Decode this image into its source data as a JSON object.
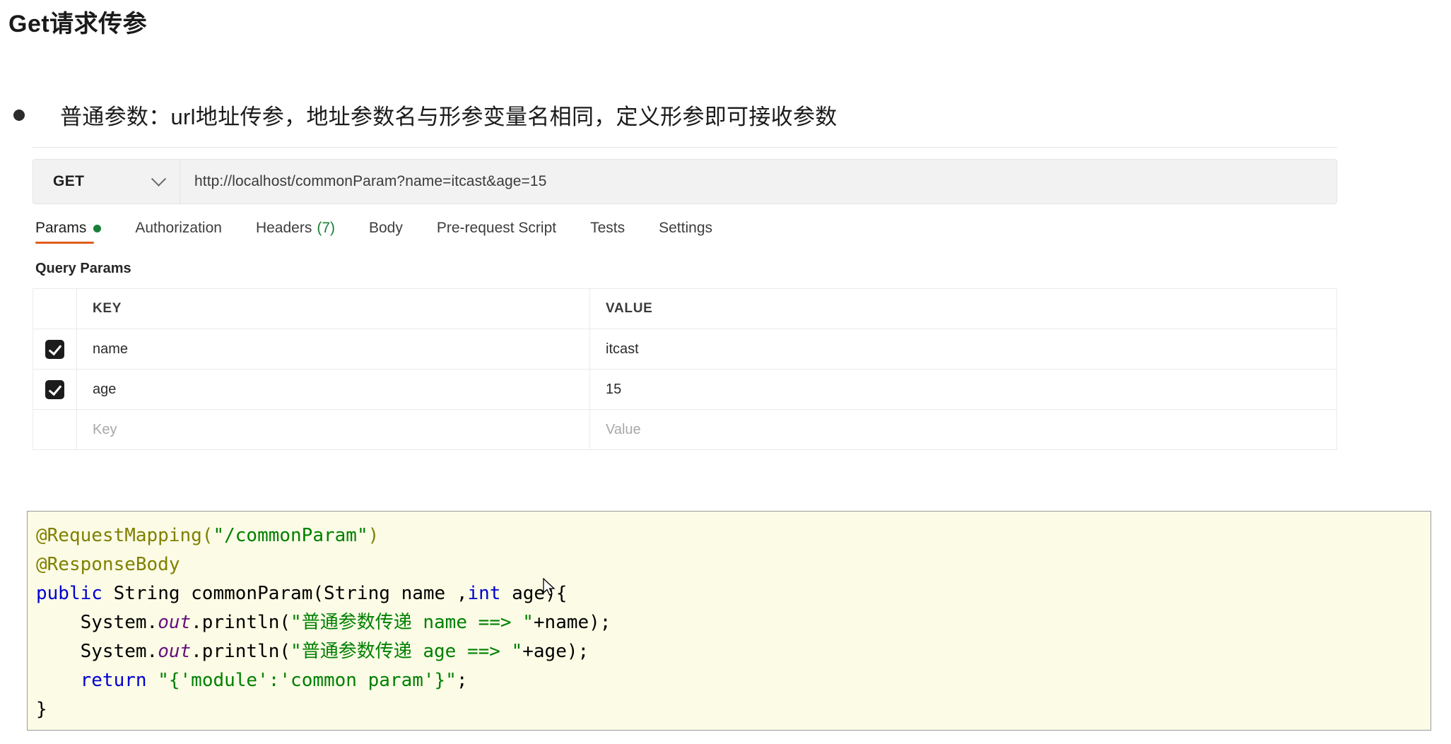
{
  "slide": {
    "title": "Get请求传参",
    "bullet": "普通参数：url地址传参，地址参数名与形参变量名相同，定义形参即可接收参数"
  },
  "postman": {
    "method": "GET",
    "method_dropdown_icon": "chevron-down-icon",
    "url": "http://localhost/commonParam?name=itcast&age=15",
    "tabs": [
      {
        "label": "Params",
        "active": true,
        "dot": true,
        "count": ""
      },
      {
        "label": "Authorization",
        "active": false,
        "dot": false,
        "count": ""
      },
      {
        "label": "Headers",
        "active": false,
        "dot": false,
        "count": "(7)"
      },
      {
        "label": "Body",
        "active": false,
        "dot": false,
        "count": ""
      },
      {
        "label": "Pre-request Script",
        "active": false,
        "dot": false,
        "count": ""
      },
      {
        "label": "Tests",
        "active": false,
        "dot": false,
        "count": ""
      },
      {
        "label": "Settings",
        "active": false,
        "dot": false,
        "count": ""
      }
    ],
    "section_label": "Query Params",
    "table": {
      "headers": {
        "key": "KEY",
        "value": "VALUE"
      },
      "rows": [
        {
          "checked": true,
          "key": "name",
          "value": "itcast",
          "placeholder": false
        },
        {
          "checked": true,
          "key": "age",
          "value": "15",
          "placeholder": false
        },
        {
          "checked": false,
          "key": "Key",
          "value": "Value",
          "placeholder": true
        }
      ]
    },
    "colors": {
      "accent_underline": "#e05d1a",
      "status_dot": "#1a7f37",
      "count_text": "#1a7f37"
    }
  },
  "code": {
    "lines": [
      [
        {
          "t": "@RequestMapping(",
          "c": "c-ann"
        },
        {
          "t": "\"/commonParam\"",
          "c": "c-str"
        },
        {
          "t": ")",
          "c": "c-ann"
        }
      ],
      [
        {
          "t": "@ResponseBody",
          "c": "c-ann"
        }
      ],
      [
        {
          "t": "public",
          "c": "c-kw"
        },
        {
          "t": " String ",
          "c": "c-plain"
        },
        {
          "t": "commonParam",
          "c": "c-plain"
        },
        {
          "t": "(String name ,",
          "c": "c-plain"
        },
        {
          "t": "int",
          "c": "c-kw"
        },
        {
          "t": " age){",
          "c": "c-plain"
        }
      ],
      [
        {
          "t": "    System.",
          "c": "c-plain"
        },
        {
          "t": "out",
          "c": "c-field"
        },
        {
          "t": ".println(",
          "c": "c-plain"
        },
        {
          "t": "\"普通参数传递 name ==> \"",
          "c": "c-str"
        },
        {
          "t": "+name);",
          "c": "c-plain"
        }
      ],
      [
        {
          "t": "    System.",
          "c": "c-plain"
        },
        {
          "t": "out",
          "c": "c-field"
        },
        {
          "t": ".println(",
          "c": "c-plain"
        },
        {
          "t": "\"普通参数传递 age ==> \"",
          "c": "c-str"
        },
        {
          "t": "+age);",
          "c": "c-plain"
        }
      ],
      [
        {
          "t": "    ",
          "c": "c-plain"
        },
        {
          "t": "return",
          "c": "c-kw"
        },
        {
          "t": " ",
          "c": "c-plain"
        },
        {
          "t": "\"{'module':'common param'}\"",
          "c": "c-str"
        },
        {
          "t": ";",
          "c": "c-plain"
        }
      ],
      [
        {
          "t": "}",
          "c": "c-plain"
        }
      ]
    ]
  }
}
